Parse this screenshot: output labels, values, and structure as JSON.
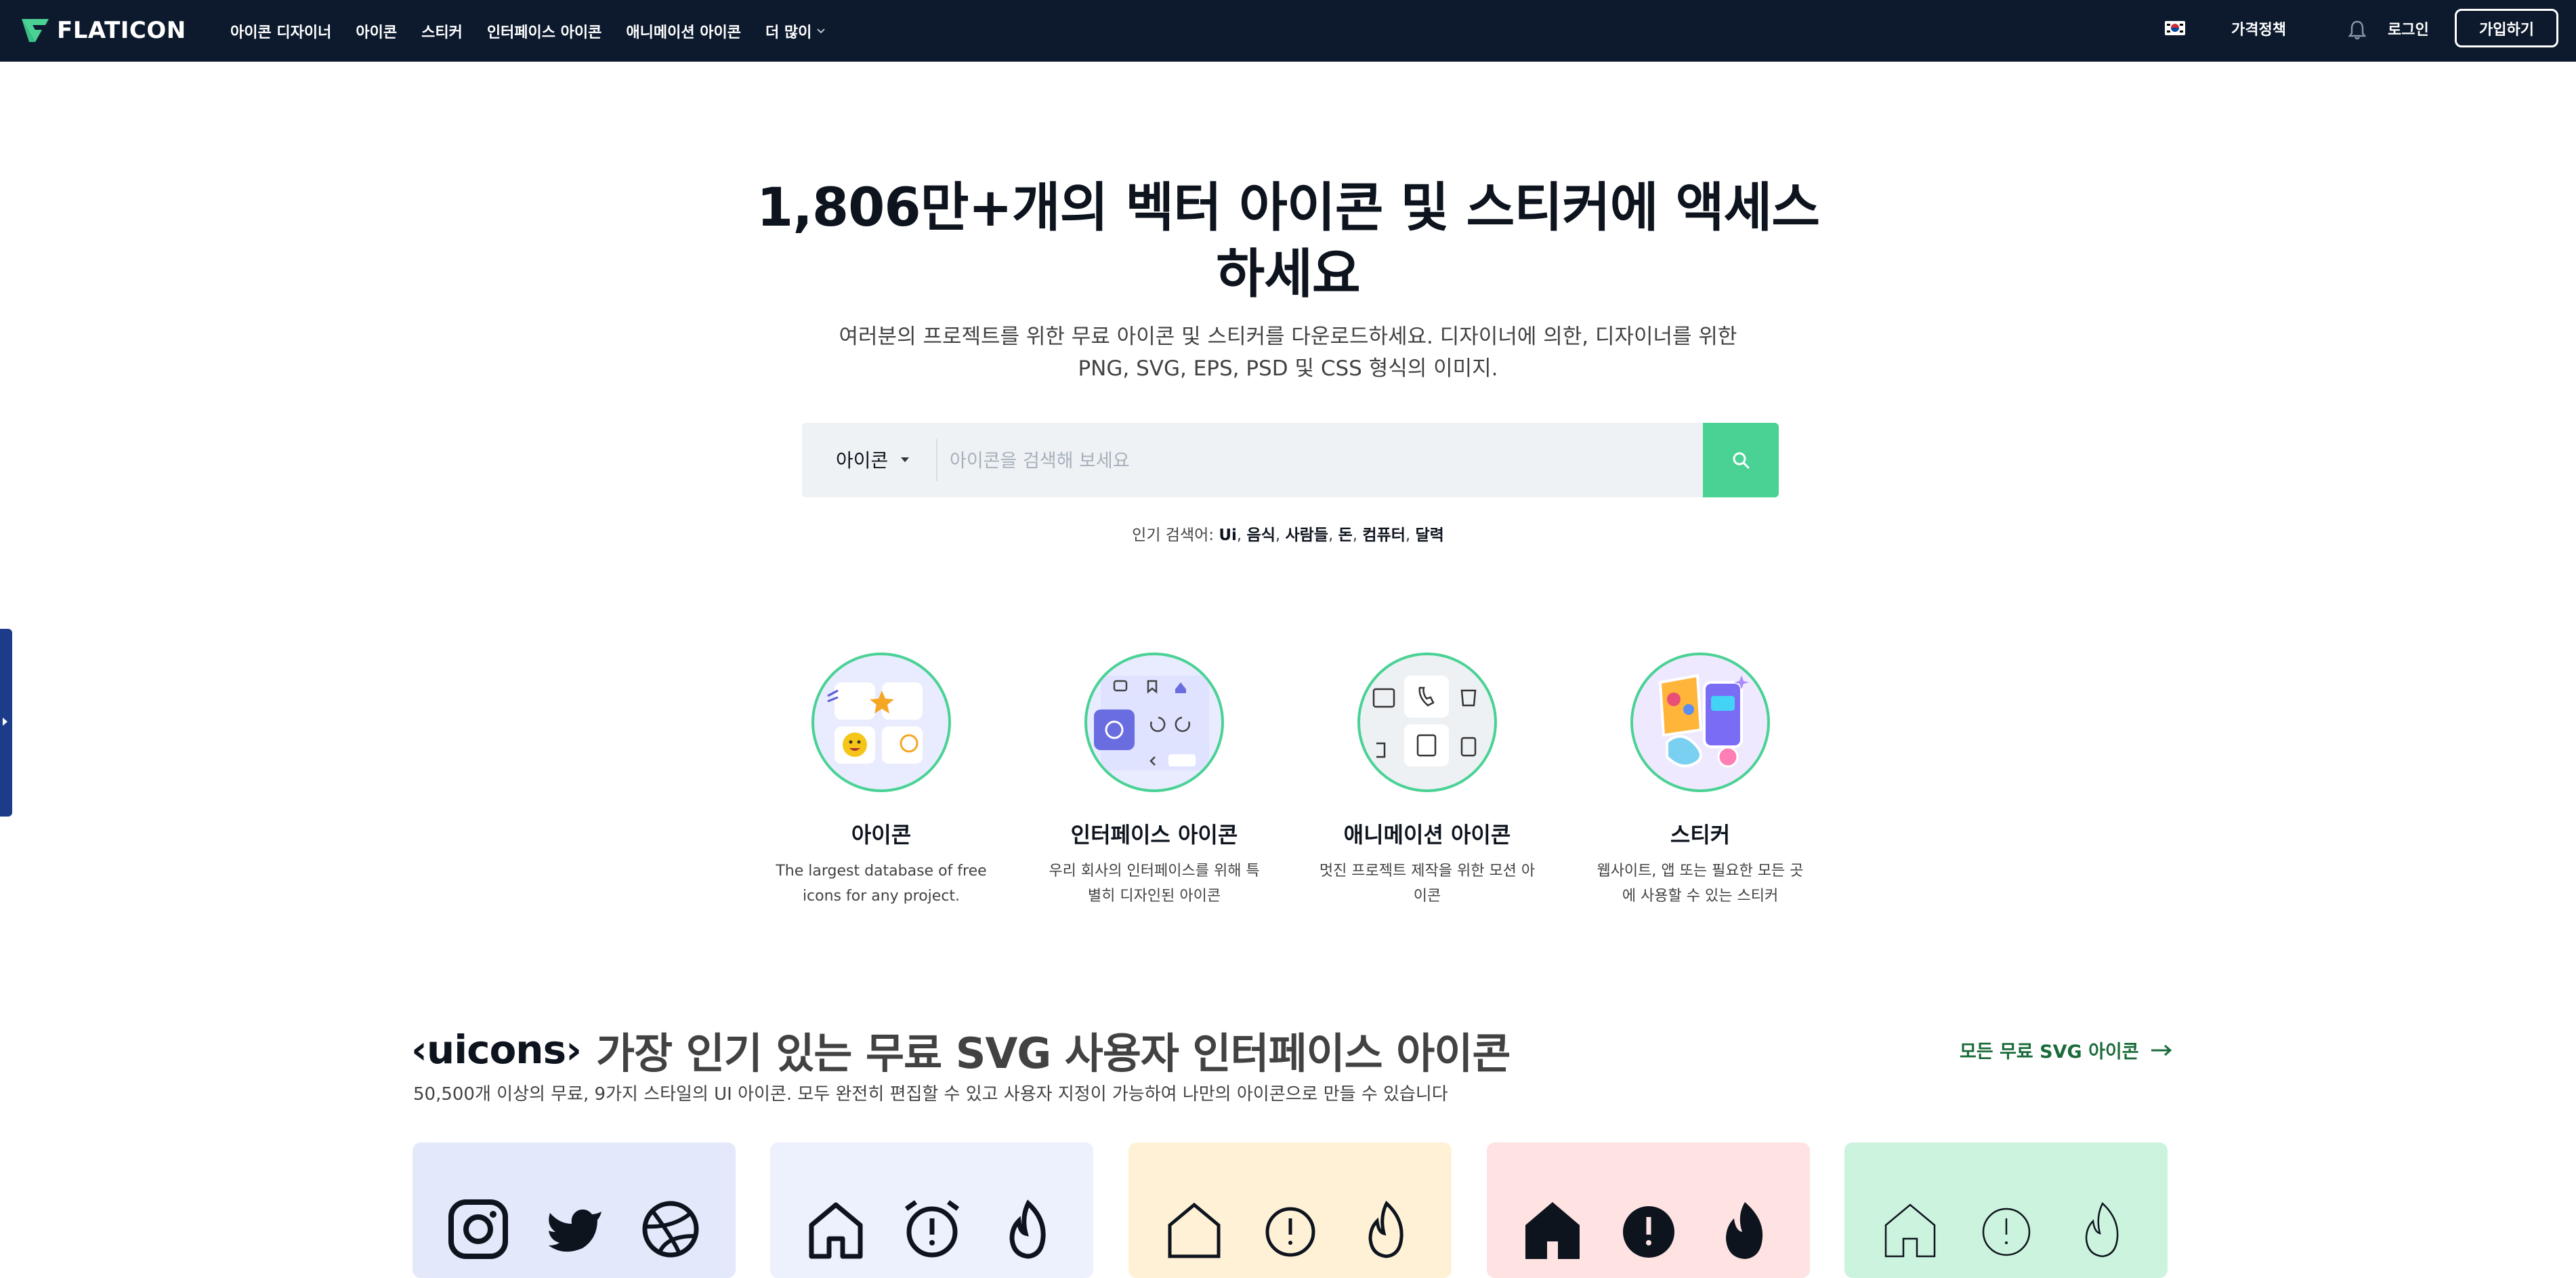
{
  "nav": {
    "brand": "FLATICON",
    "menu": [
      "아이콘 디자이너",
      "아이콘",
      "스티커",
      "인터페이스 아이콘",
      "애니메이션 아이콘"
    ],
    "more_label": "더 많이",
    "pricing": "가격정책",
    "login": "로그인",
    "signup": "가입하기"
  },
  "hero": {
    "title_line1": "1,806만+개의 벡터 아이콘 및 스티커에 액세스",
    "title_line2": "하세요",
    "subtitle_line1": "여러분의 프로젝트를 위한 무료 아이콘 및 스티커를 다운로드하세요. 디자이너에 의한, 디자이너를 위한",
    "subtitle_line2": "PNG, SVG, EPS, PSD 및 CSS 형식의 이미지."
  },
  "search": {
    "type_selected": "아이콘",
    "placeholder": "아이콘을 검색해 보세요",
    "value": ""
  },
  "popular": {
    "label": "인기 검색어:",
    "terms": [
      "Ui",
      "음식",
      "사람들",
      "돈",
      "컴퓨터",
      "달력"
    ]
  },
  "categories": [
    {
      "name": "아이콘",
      "desc": "The largest database of free icons for any project."
    },
    {
      "name": "인터페이스 아이콘",
      "desc": "우리 회사의 인터페이스를 위해 특별히 디자인된 아이콘"
    },
    {
      "name": "애니메이션 아이콘",
      "desc": "멋진 프로젝트 제작을 위한 모션 아이콘"
    },
    {
      "name": "스티커",
      "desc": "웹사이트, 앱 또는 필요한 모든 곳에 사용할 수 있는 스티커"
    }
  ],
  "uicons": {
    "logo": "‹uicons›",
    "title": "가장 인기 있는 무료 SVG 사용자 인터페이스 아이콘",
    "subtitle": "50,500개 이상의 무료, 9가지 스타일의 UI 아이콘. 모두 완전히 편집할 수 있고 사용자 지정이 가능하여 나만의 아이콘으로 만들 수 있습니다",
    "all_link": "모든 무료 SVG 아이콘",
    "card_colors": [
      "#e3e8fb",
      "#edf0fd",
      "#fff1d6",
      "#ffe3e3",
      "#ccf3de"
    ]
  },
  "colors": {
    "nav_bg": "#0d1a2d",
    "accent_green": "#4ad295",
    "link_green": "#1a6b3a"
  }
}
